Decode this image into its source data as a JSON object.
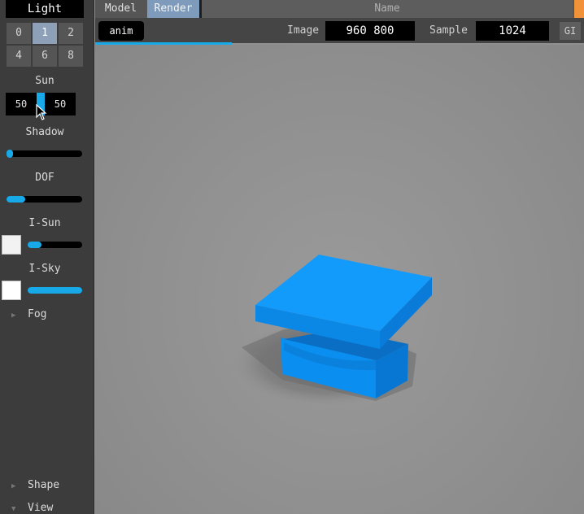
{
  "sidebar": {
    "title": "Light",
    "light_buttons": [
      {
        "label": "0",
        "active": false
      },
      {
        "label": "1",
        "active": true
      },
      {
        "label": "2",
        "active": false
      },
      {
        "label": "4",
        "active": false
      },
      {
        "label": "6",
        "active": false
      },
      {
        "label": "8",
        "active": false
      }
    ],
    "sun": {
      "label": "Sun",
      "value_left": "50",
      "value_right": "50"
    },
    "shadow": {
      "label": "Shadow",
      "level": 0.0
    },
    "dof": {
      "label": "DOF",
      "level": 0.25
    },
    "i_sun": {
      "label": "I-Sun",
      "level": 0.25
    },
    "i_sky": {
      "label": "I-Sky",
      "level": 1.0
    },
    "fog": {
      "label": "Fog"
    },
    "shape": {
      "label": "Shape"
    },
    "view": {
      "label": "View"
    }
  },
  "topbar": {
    "tabs": [
      {
        "label": "Model",
        "active": false
      },
      {
        "label": "Render",
        "active": true
      }
    ],
    "name_placeholder": "Name"
  },
  "render_bar": {
    "anim_label": "anim",
    "image_label": "Image",
    "image_value": "960 800",
    "sample_label": "Sample",
    "sample_value": "1024",
    "gi_label": "GI",
    "progress": 0.28
  },
  "colors": {
    "accent": "#17a9e8",
    "active_tab": "#7f9bbb",
    "warning_accent": "#f09237",
    "object": "#0a8ff0"
  }
}
